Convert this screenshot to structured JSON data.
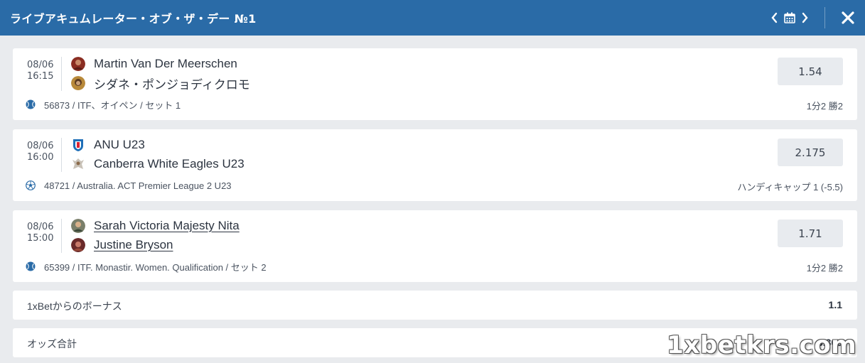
{
  "header": {
    "title": "ライブアキュムレーター・オブ・ザ・デー №1"
  },
  "matches": [
    {
      "date": "08/06",
      "time": "16:15",
      "team1": "Martin Van Der Meerschen",
      "team2": "シダネ・ポンジョディクロモ",
      "odd": "1.54",
      "sport_icon": "tennis-ball-icon",
      "league": "56873 / ITF、オイペン / セット 1",
      "bet": "1分2 勝2"
    },
    {
      "date": "08/06",
      "time": "16:00",
      "team1": "ANU U23",
      "team2": "Canberra White Eagles U23",
      "odd": "2.175",
      "sport_icon": "soccer-ball-icon",
      "league": "48721 / Australia. ACT Premier League 2 U23",
      "bet": "ハンディキャップ 1 (-5.5)"
    },
    {
      "date": "08/06",
      "time": "15:00",
      "team1": "Sarah Victoria Majesty Nita",
      "team2": "Justine Bryson",
      "odd": "1.71",
      "sport_icon": "tennis-ball-icon",
      "league": "65399 / ITF. Monastir. Women. Qualification / セット 2",
      "bet": "1分2 勝2"
    }
  ],
  "bonus": {
    "label": "1xBetからのボーナス",
    "value": "1.1"
  },
  "total": {
    "label": "オッズ合計",
    "value": "6.300"
  },
  "watermark": "1xbetkrs.com",
  "colors": {
    "header_bg": "#2a6ba7",
    "page_bg": "#e9ebee",
    "odd_bg": "#e8ebef"
  }
}
